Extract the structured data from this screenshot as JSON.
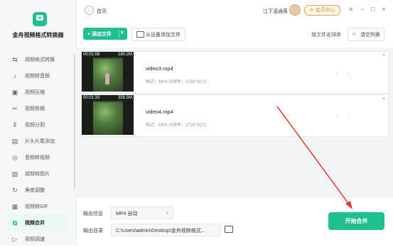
{
  "app": {
    "title": "金舟视频格式转换器"
  },
  "topbar": {
    "breadcrumb": "首页",
    "username": "江下凌通英",
    "vip_label": "会员中心",
    "menu_icon": "≡",
    "minimize_icon": "−",
    "maximize_icon": "□",
    "close_icon": "×"
  },
  "sidebar": {
    "items": [
      {
        "label": "视频格式转换",
        "icon": "format-icon",
        "glyph": "⇆"
      },
      {
        "label": "视频转音频",
        "icon": "audio-wave-icon",
        "glyph": "♪"
      },
      {
        "label": "视频压缩",
        "icon": "compress-icon",
        "glyph": "▣"
      },
      {
        "label": "视频剪辑",
        "icon": "cut-icon",
        "glyph": "✂"
      },
      {
        "label": "视频分割",
        "icon": "split-icon",
        "glyph": "⫴"
      },
      {
        "label": "片头片尾添加",
        "icon": "film-icon",
        "glyph": "▤"
      },
      {
        "label": "音频转视频",
        "icon": "music-disc-icon",
        "glyph": "◎"
      },
      {
        "label": "视频转图片",
        "icon": "image-icon",
        "glyph": "▨"
      },
      {
        "label": "角度调整",
        "icon": "rotate-icon",
        "glyph": "↻"
      },
      {
        "label": "视频转GIF",
        "icon": "gif-icon",
        "glyph": "▦"
      },
      {
        "label": "视频合并",
        "icon": "merge-icon",
        "glyph": "⧉",
        "active": true
      },
      {
        "label": "视频调速",
        "icon": "speed-icon",
        "glyph": "▷"
      }
    ]
  },
  "toolbar": {
    "add_label": "+ 添加文件",
    "add_dropdown": "▾",
    "device_label": "从设备添加文件",
    "sort_label": "按文件名排序",
    "clear_label": "清空列表",
    "clear_glyph": "🗑"
  },
  "files": [
    {
      "time": "00:01:08",
      "size": "180.2M",
      "name": "video3.mp4",
      "meta": "格式：MP4    分辨率：1728*3072",
      "up": "↑",
      "down": "↓",
      "close": "×"
    },
    {
      "time": "00:01:33",
      "size": "356.5M",
      "name": "video4.mp4",
      "meta": "格式：MP4    分辨率：1728*3072",
      "up": "↑",
      "down": "↓",
      "close": "×"
    }
  ],
  "output": {
    "format_label": "输出信息",
    "format_value": "MP4 自动",
    "dir_label": "输出目录",
    "dir_value": "C:\\Users\\admin\\Desktop\\金舟视频格式...",
    "chevron": "›"
  },
  "merge_button": "开始合并",
  "colors": {
    "accent": "#1fbf8f",
    "vip": "#f0a24a",
    "annotation_arrow": "#e53935"
  }
}
